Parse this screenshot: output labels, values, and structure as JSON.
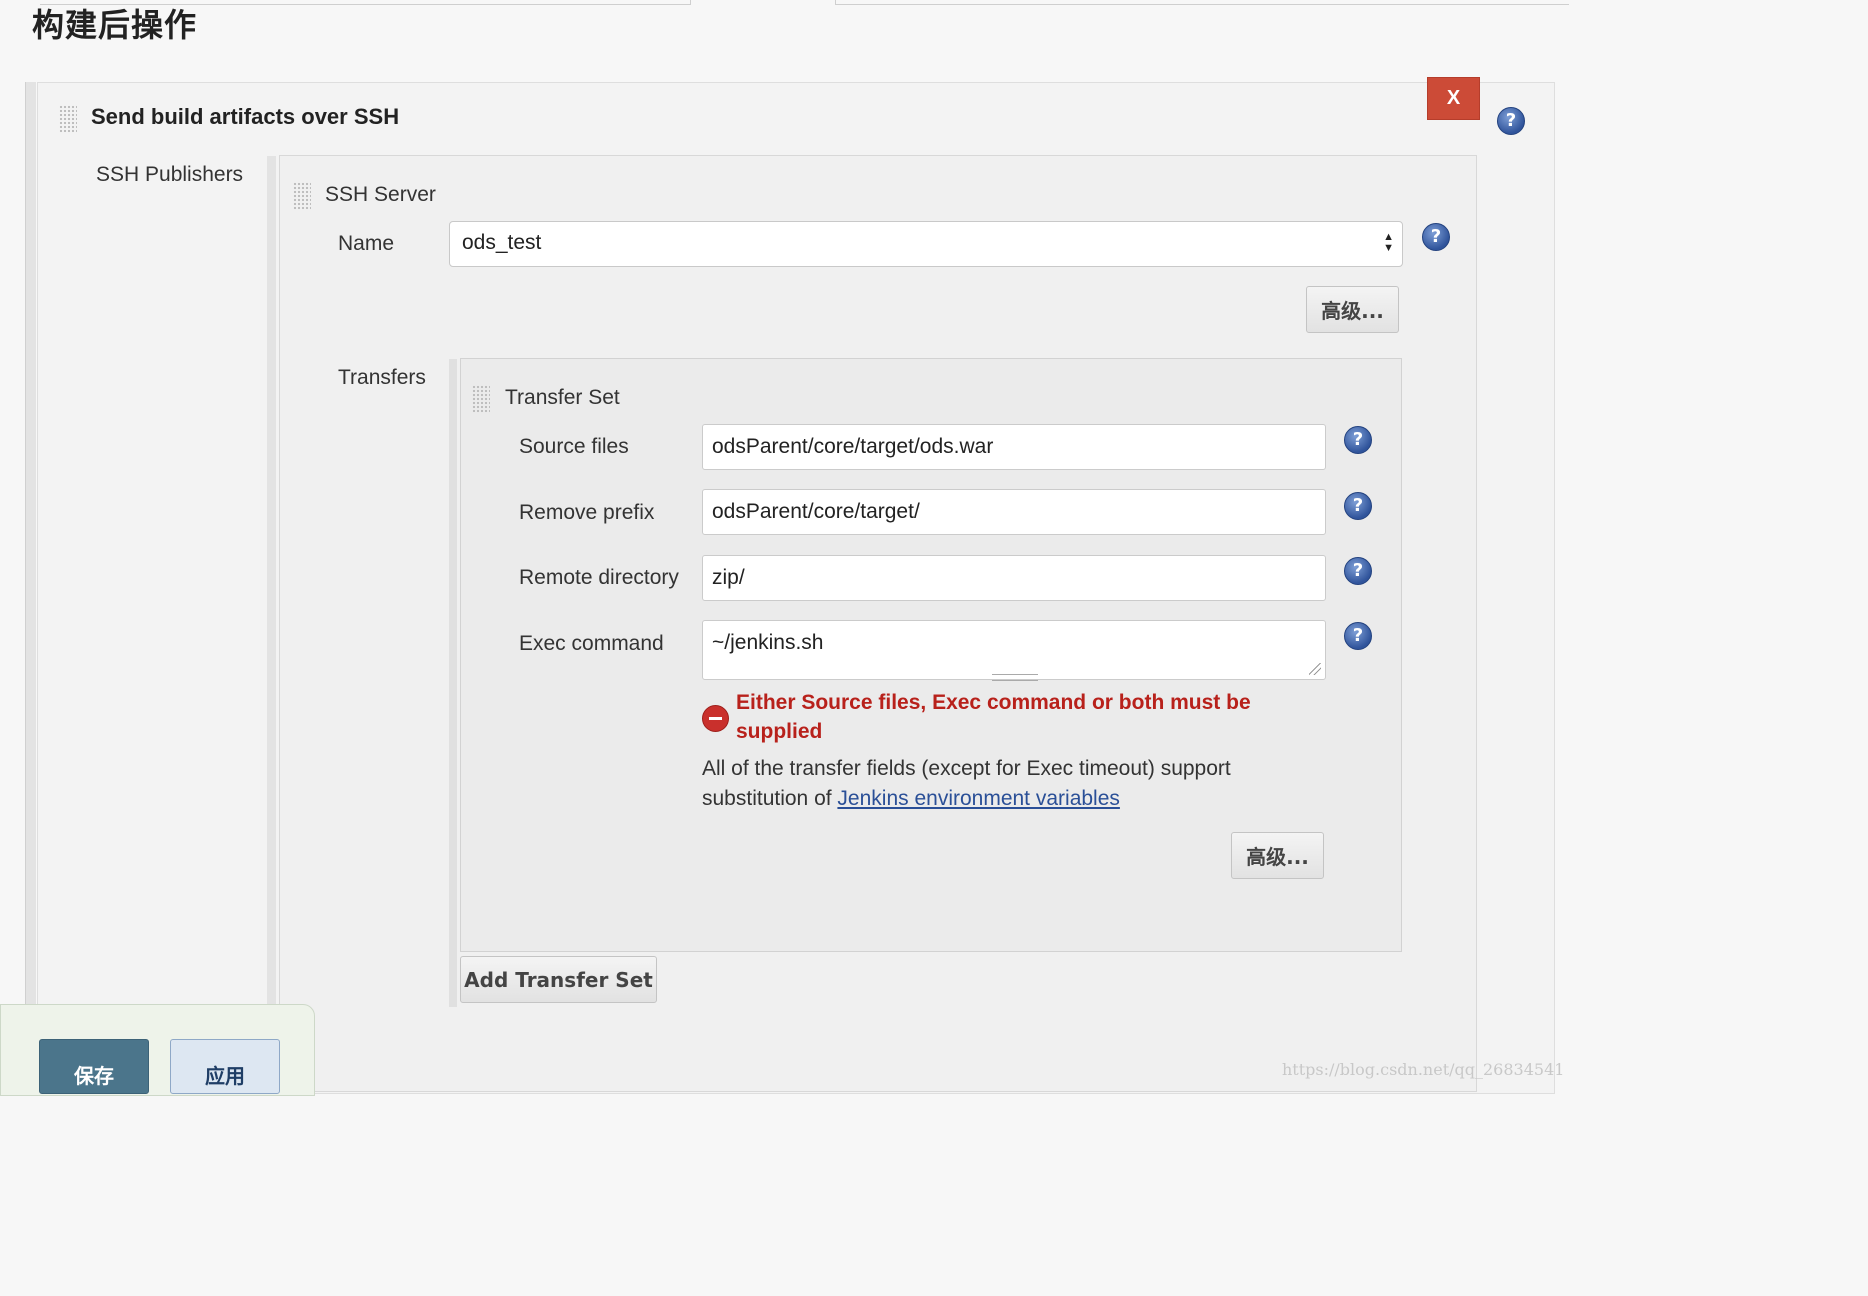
{
  "section": {
    "title": "构建后操作"
  },
  "publisher": {
    "title": "Send build artifacts over SSH",
    "close_label": "X",
    "ssh_publishers_label": "SSH Publishers",
    "ssh_server_label": "SSH Server",
    "name_label": "Name",
    "name_value": "ods_test",
    "advanced_label": "高级..."
  },
  "transfers": {
    "label": "Transfers",
    "set_title": "Transfer Set",
    "fields": {
      "source_files": {
        "label": "Source files",
        "value": "odsParent/core/target/ods.war"
      },
      "remove_prefix": {
        "label": "Remove prefix",
        "value": "odsParent/core/target/"
      },
      "remote_directory": {
        "label": "Remote directory",
        "value": "zip/"
      },
      "exec_command": {
        "label": "Exec command",
        "value": "~/jenkins.sh"
      }
    },
    "error_message": "Either Source files, Exec command or both must be supplied",
    "info_prefix": "All of the transfer fields (except for Exec timeout) support substitution of ",
    "info_link": "Jenkins environment variables",
    "advanced_label": "高级...",
    "add_button_label": "Add Transfer Set"
  },
  "footer": {
    "save_label": "保存",
    "apply_label": "应用"
  },
  "watermark": "https://blog.csdn.net/qq_26834541",
  "help_glyph": "?",
  "icons": {
    "help": "help-icon",
    "error": "error-icon",
    "drag": "drag-handle-icon"
  },
  "colors": {
    "close": "#cc4b37",
    "error": "#b8211b",
    "save": "#4b758b",
    "link": "#2a4f97"
  }
}
